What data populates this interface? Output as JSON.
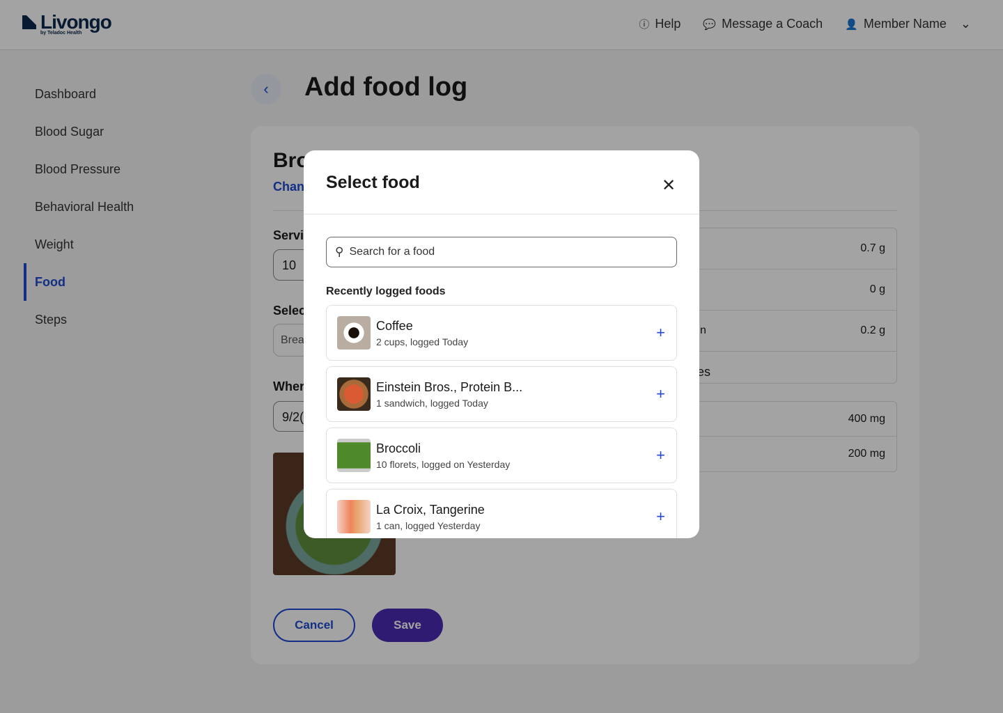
{
  "header": {
    "logo": "Livongo",
    "logo_sub": "by Teladoc Health",
    "help": "Help",
    "message": "Message a Coach",
    "member": "Member Name"
  },
  "sidebar": {
    "items": [
      {
        "label": "Dashboard"
      },
      {
        "label": "Blood Sugar"
      },
      {
        "label": "Blood Pressure"
      },
      {
        "label": "Behavioral Health"
      },
      {
        "label": "Weight"
      },
      {
        "label": "Food",
        "active": true
      },
      {
        "label": "Steps"
      }
    ]
  },
  "page": {
    "title": "Add food log",
    "heading_fragment": "Bro",
    "change_fragment": "Chan",
    "servings_label_fragment": "Servi",
    "servings_value": "10",
    "select_label_fragment": "Selec",
    "meal_fragment": "Brea",
    "when_label_fragment": "Wher",
    "date_fragment": "9/2(",
    "nutrients": [
      "0.7 g",
      "0 g",
      "0.2 g"
    ],
    "nutrient_label_fragment_1": "n",
    "nutrient_label_fragment_2": "es",
    "minerals": [
      "400 mg",
      "200 mg"
    ],
    "cancel": "Cancel",
    "save": "Save"
  },
  "modal": {
    "title": "Select food",
    "search_placeholder": "Search for a food",
    "section": "Recently logged foods",
    "items": [
      {
        "name": "Coffee",
        "detail": "2 cups, logged Today"
      },
      {
        "name": "Einstein Bros., Protein B...",
        "detail": "1 sandwich, logged Today"
      },
      {
        "name": "Broccoli",
        "detail": "10 florets, logged on Yesterday"
      },
      {
        "name": "La Croix, Tangerine",
        "detail": "1 can, logged Yesterday"
      }
    ]
  },
  "colors": {
    "accent": "#1f4ad1",
    "primary": "#4b2bb5",
    "brand": "#0d2a4d"
  }
}
